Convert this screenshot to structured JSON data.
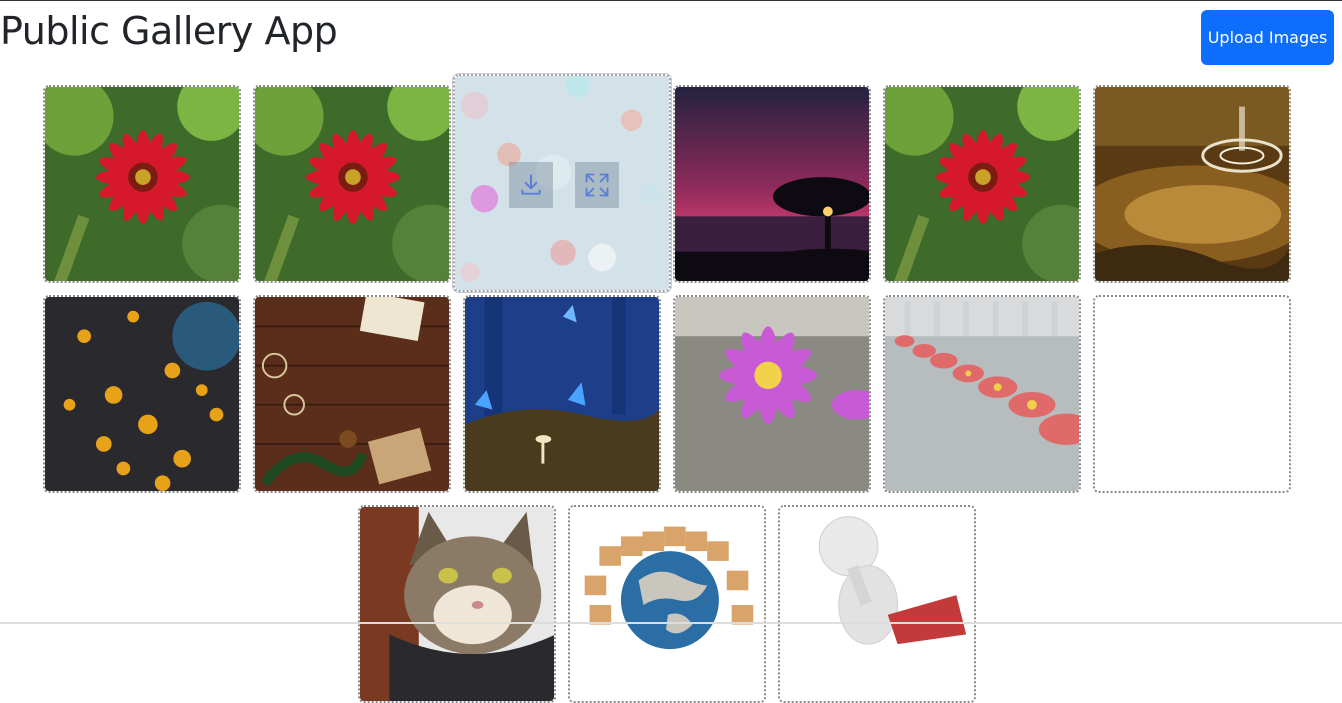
{
  "header": {
    "title": "Public Gallery App",
    "upload_label": "Upload Images",
    "accent": "#0d6efd"
  },
  "gallery": {
    "hover_actions": [
      {
        "icon": "download-icon"
      },
      {
        "icon": "expand-icon"
      }
    ],
    "images": [
      {
        "subject": "red-gerbera-flower"
      },
      {
        "subject": "red-gerbera-flower"
      },
      {
        "subject": "bokeh-lights-pastel",
        "hovered": true
      },
      {
        "subject": "tree-sunset-sea"
      },
      {
        "subject": "red-gerbera-flower"
      },
      {
        "subject": "water-drop-splash"
      },
      {
        "subject": "golden-bokeh-lights"
      },
      {
        "subject": "christmas-wood-gift"
      },
      {
        "subject": "blue-butterflies-mushrooms"
      },
      {
        "subject": "pink-water-lily"
      },
      {
        "subject": "flowers-on-marble-ledge"
      },
      {
        "subject": "empty-placeholder"
      },
      {
        "subject": "tabby-cat"
      },
      {
        "subject": "globe-with-boxes"
      },
      {
        "subject": "thinking-3d-figure"
      }
    ]
  }
}
